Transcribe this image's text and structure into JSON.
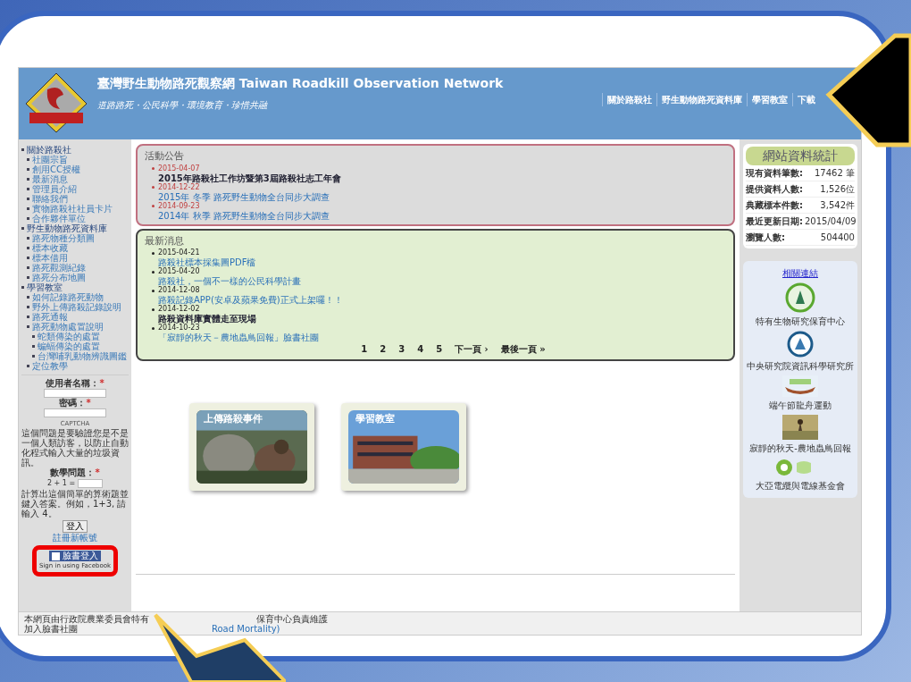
{
  "header": {
    "title": "臺灣野生動物路死觀察網 Taiwan Roadkill Observation Network",
    "subtitle": "道路路死・公民科學・環境教育・珍惜共融",
    "nav": [
      "關於路殺社",
      "野生動物路死資料庫",
      "學習教室",
      "下載"
    ]
  },
  "sidebar": {
    "menu": [
      {
        "label": "關於路殺社",
        "children": [
          {
            "label": "社團宗旨"
          },
          {
            "label": "創用CC授權"
          },
          {
            "label": "最新消息"
          },
          {
            "label": "管理員介紹"
          },
          {
            "label": "聯絡我們"
          },
          {
            "label": "實物路殺社社員卡片"
          },
          {
            "label": "合作夥伴單位"
          }
        ]
      },
      {
        "label": "野生動物路死資料庫",
        "children": [
          {
            "label": "路死物種分類圖"
          },
          {
            "label": "標本收藏"
          },
          {
            "label": "標本借用"
          },
          {
            "label": "路死觀測紀錄"
          },
          {
            "label": "路死分布地圖"
          }
        ]
      },
      {
        "label": "學習教室",
        "children": [
          {
            "label": "如何記錄路死動物"
          },
          {
            "label": "野外上傳路殺記錄說明"
          },
          {
            "label": "路死通報"
          },
          {
            "label": "路死動物處置說明",
            "children": [
              {
                "label": "蛇類傳染的處置"
              },
              {
                "label": "蝙蝠傳染的處置"
              },
              {
                "label": "台灣哺乳動物辨識圖鑑"
              }
            ]
          },
          {
            "label": "定位教學"
          }
        ]
      }
    ],
    "login": {
      "username_label": "使用者名稱：",
      "password_label": "密碼：",
      "required": "*",
      "captcha_title": "CAPTCHA",
      "captcha_text": "這個問題是要驗證您是不是一個人類訪客，以防止自動化程式輸入大量的垃圾資訊。",
      "math_label": "數學問題：",
      "math_question": "2 + 1 =",
      "math_hint": "計算出這個簡單的算術題並鍵入答案。例如，1+3, 請輸入 4。",
      "login_button": "登入",
      "register_link": "註冊新帳號",
      "facebook_button": "臉書登入",
      "facebook_caption": "Sign in using Facebook"
    }
  },
  "announcements": {
    "title": "活動公告",
    "items": [
      {
        "date": "2015-04-07",
        "text": "2015年路殺社工作坊暨第3屆路殺社志工年會",
        "link": false
      },
      {
        "date": "2014-12-22",
        "text": "2015年 冬季 路死野生動物全台同步大調查",
        "link": true
      },
      {
        "date": "2014-09-23",
        "text": "2014年 秋季 路死野生動物全台同步大調查",
        "link": true
      }
    ]
  },
  "news": {
    "title": "最新消息",
    "items": [
      {
        "date": "2015-04-21",
        "text": "路殺社標本採集圖PDF檔",
        "link": true
      },
      {
        "date": "2015-04-20",
        "text": "路殺社，一個不一樣的公民科學計畫",
        "link": true
      },
      {
        "date": "2014-12-08",
        "text": "路殺記錄APP(安卓及蘋果免費)正式上架囉！！",
        "link": true
      },
      {
        "date": "2014-12-02",
        "text": "路殺資料庫實體走至現場",
        "link": false
      },
      {
        "date": "2014-10-23",
        "text": "「寂靜的秋天－農地蟲鳥回報」臉書社團",
        "link": true
      }
    ],
    "pager": [
      "1",
      "2",
      "3",
      "4",
      "5",
      "下一頁 ›",
      "最後一頁 »"
    ]
  },
  "cards": [
    {
      "label": "上傳路殺事件"
    },
    {
      "label": "學習教室"
    }
  ],
  "stats": {
    "title": "網站資料統計",
    "rows": [
      {
        "label": "現有資料筆數:",
        "value": "17462 筆"
      },
      {
        "label": "提供資料人數:",
        "value": "1,526位"
      },
      {
        "label": "典藏標本件數:",
        "value": "3,542件"
      },
      {
        "label": "最近更新日期:",
        "value": "2015/04/09"
      },
      {
        "label": "瀏覽人數:",
        "value": "504400"
      }
    ]
  },
  "links": {
    "title": "相關連結",
    "items": [
      {
        "label": "特有生物研究保育中心",
        "kind": "green-emblem"
      },
      {
        "label": "中央研究院資訊科學研究所",
        "kind": "blue-emblem"
      },
      {
        "label": "端午節龍舟運動",
        "kind": "boat"
      },
      {
        "label": "寂靜的秋天-農地蟲鳥回報",
        "kind": "field"
      },
      {
        "label": "大亞電纜與電線基金會",
        "kind": "flower"
      }
    ]
  },
  "footer": {
    "line_1": "本網頁由行政院農業委員會特有",
    "line_1_end": "保育中心負責維護",
    "line_2": "加入臉書社團",
    "line_2_link": "Road Mortality)"
  }
}
